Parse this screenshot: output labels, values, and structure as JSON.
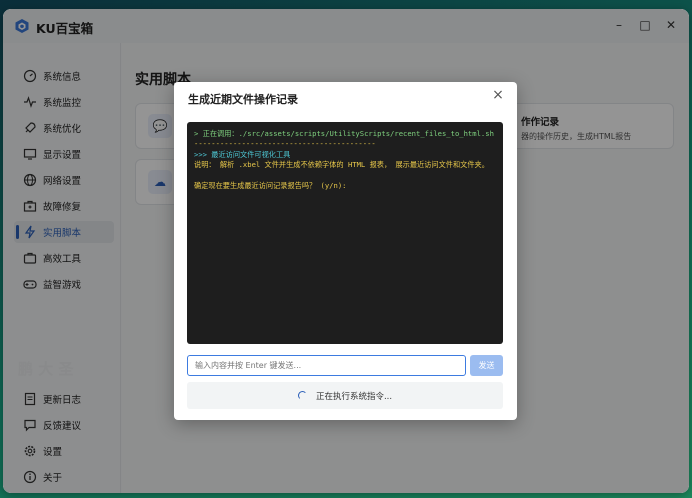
{
  "app": {
    "title": "KU百宝箱"
  },
  "window_controls": {
    "minimize": "–",
    "maximize": "□",
    "close": "✕"
  },
  "sidebar": {
    "items": [
      {
        "label": "系统信息",
        "icon": "dashboard-icon"
      },
      {
        "label": "系统监控",
        "icon": "pulse-icon"
      },
      {
        "label": "系统优化",
        "icon": "rocket-icon"
      },
      {
        "label": "显示设置",
        "icon": "monitor-icon"
      },
      {
        "label": "网络设置",
        "icon": "globe-icon"
      },
      {
        "label": "故障修复",
        "icon": "toolbox-icon"
      },
      {
        "label": "实用脚本",
        "icon": "bolt-icon",
        "active": true
      },
      {
        "label": "高效工具",
        "icon": "tools-icon"
      },
      {
        "label": "益智游戏",
        "icon": "gamepad-icon"
      }
    ],
    "bottom_items": [
      {
        "label": "更新日志",
        "icon": "document-icon"
      },
      {
        "label": "反馈建议",
        "icon": "chat-icon"
      },
      {
        "label": "设置",
        "icon": "gear-icon"
      },
      {
        "label": "关于",
        "icon": "info-icon"
      }
    ]
  },
  "main": {
    "page_title": "实用脚本",
    "right_card": {
      "title": "作作记录",
      "desc": "器的操作历史，生成HTML报告"
    }
  },
  "dialog": {
    "title": "生成近期文件操作记录",
    "close_label": "×",
    "terminal_lines": [
      "> 正在调用：./src/assets/scripts/UtilityScripts/recent_files_to_html.sh",
      "------------------------------------------",
      ">>> 最近访问文件可视化工具",
      "说明： 解析 .xbel 文件并生成不依赖字体的 HTML 报表， 展示最近访问文件和文件夹。",
      "确定现在要生成最近访问记录报告吗？ (y/n):"
    ],
    "input_placeholder": "输入内容并按 Enter 键发送...",
    "send_label": "发送",
    "status_text": "正在执行系统指令..."
  },
  "colors": {
    "accent": "#2b5fb8",
    "terminal_bg": "#1e1e1e",
    "terminal_cmd": "#7fd17f",
    "terminal_info": "#e8c84a",
    "terminal_head": "#4ec9d6"
  }
}
